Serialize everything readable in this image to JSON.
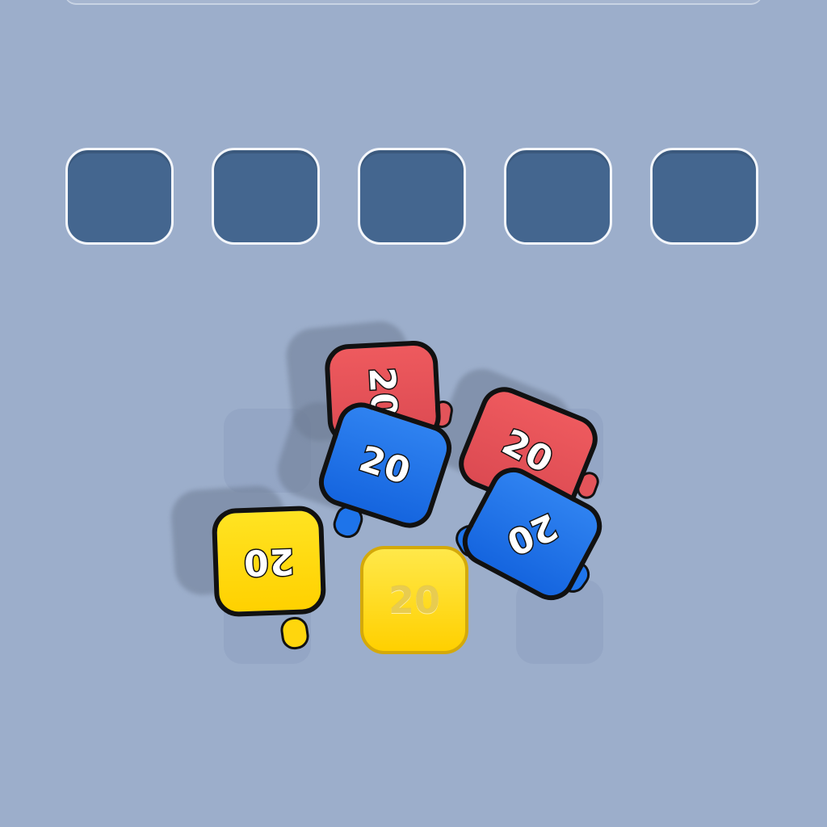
{
  "colors": {
    "background": "#9caecb",
    "slot": "#44668f",
    "red": "#e3545a",
    "blue": "#1e74ea",
    "yellow": "#ffd60d"
  },
  "slots": [
    "",
    "",
    "",
    "",
    ""
  ],
  "blocks": [
    {
      "color": "red",
      "label": "20"
    },
    {
      "color": "blue",
      "label": "20"
    },
    {
      "color": "red",
      "label": "20"
    },
    {
      "color": "blue",
      "label": "20"
    },
    {
      "color": "yellow",
      "label": "20"
    }
  ],
  "ghost_block": {
    "color": "yellow",
    "label": "20"
  }
}
